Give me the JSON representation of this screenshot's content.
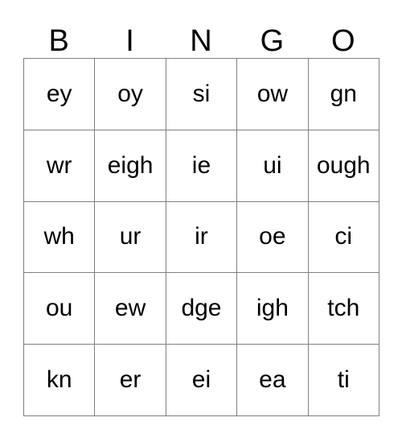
{
  "card": {
    "title": "BINGO",
    "column_headers": [
      "B",
      "I",
      "N",
      "G",
      "O"
    ],
    "grid": [
      [
        "ey",
        "oy",
        "si",
        "ow",
        "gn"
      ],
      [
        "wr",
        "eigh",
        "ie",
        "ui",
        "ough"
      ],
      [
        "wh",
        "ur",
        "ir",
        "oe",
        "ci"
      ],
      [
        "ou",
        "ew",
        "dge",
        "igh",
        "tch"
      ],
      [
        "kn",
        "er",
        "ei",
        "ea",
        "ti"
      ]
    ],
    "colors": {
      "border": "#808080",
      "text": "#000000",
      "background": "#ffffff"
    },
    "rows": 5,
    "columns": 5,
    "free_space": false
  }
}
